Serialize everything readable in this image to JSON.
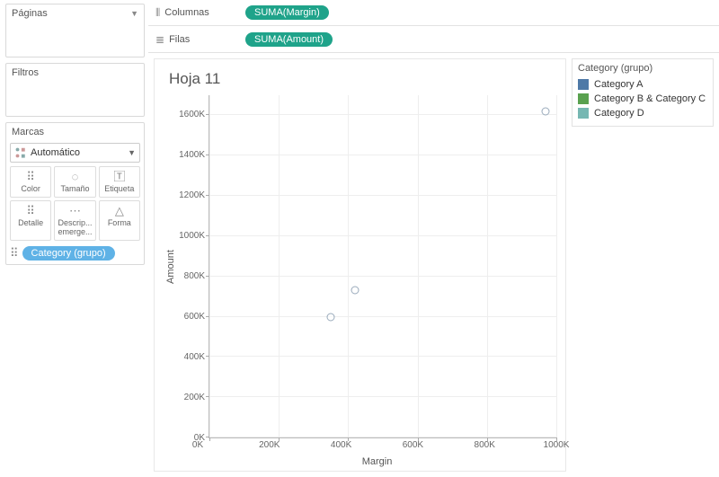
{
  "sidebar": {
    "pages_label": "Páginas",
    "filters_label": "Filtros",
    "marks_label": "Marcas",
    "mark_type": "Automático",
    "buttons": {
      "color": "Color",
      "size": "Tamaño",
      "label": "Etiqueta",
      "detail": "Detalle",
      "tooltip": "Descrip... emerge...",
      "shape": "Forma"
    },
    "color_pill": "Category (grupo)"
  },
  "shelves": {
    "columns_label": "Columnas",
    "rows_label": "Filas",
    "columns_pill": "SUMA(Margin)",
    "rows_pill": "SUMA(Amount)"
  },
  "viz": {
    "title": "Hoja 11",
    "xlabel": "Margin",
    "ylabel": "Amount",
    "y_ticks": [
      "1600K",
      "1400K",
      "1200K",
      "1000K",
      "800K",
      "600K",
      "400K",
      "200K",
      "0K"
    ],
    "x_ticks": [
      "0K",
      "200K",
      "400K",
      "600K",
      "800K",
      "1000K"
    ]
  },
  "legend": {
    "title": "Category (grupo)",
    "items": [
      {
        "label": "Category A",
        "color": "#4e79a7"
      },
      {
        "label": "Category B & Category C",
        "color": "#59a14f"
      },
      {
        "label": "Category D",
        "color": "#76b7b2"
      }
    ]
  },
  "chart_data": {
    "type": "scatter",
    "title": "Hoja 11",
    "xlabel": "Margin",
    "ylabel": "Amount",
    "xlim": [
      0,
      1000000
    ],
    "ylim": [
      0,
      1700000
    ],
    "series": [
      {
        "name": "Category A",
        "color": "#4e79a7",
        "x": [
          350000
        ],
        "y": [
          600000
        ]
      },
      {
        "name": "Category B & Category C",
        "color": "#59a14f",
        "x": [
          420000
        ],
        "y": [
          730000
        ]
      },
      {
        "name": "Category D",
        "color": "#76b7b2",
        "x": [
          970000
        ],
        "y": [
          1620000
        ]
      }
    ],
    "x_ticks": [
      0,
      200000,
      400000,
      600000,
      800000,
      1000000
    ],
    "y_ticks": [
      0,
      200000,
      400000,
      600000,
      800000,
      1000000,
      1200000,
      1400000,
      1600000
    ]
  }
}
